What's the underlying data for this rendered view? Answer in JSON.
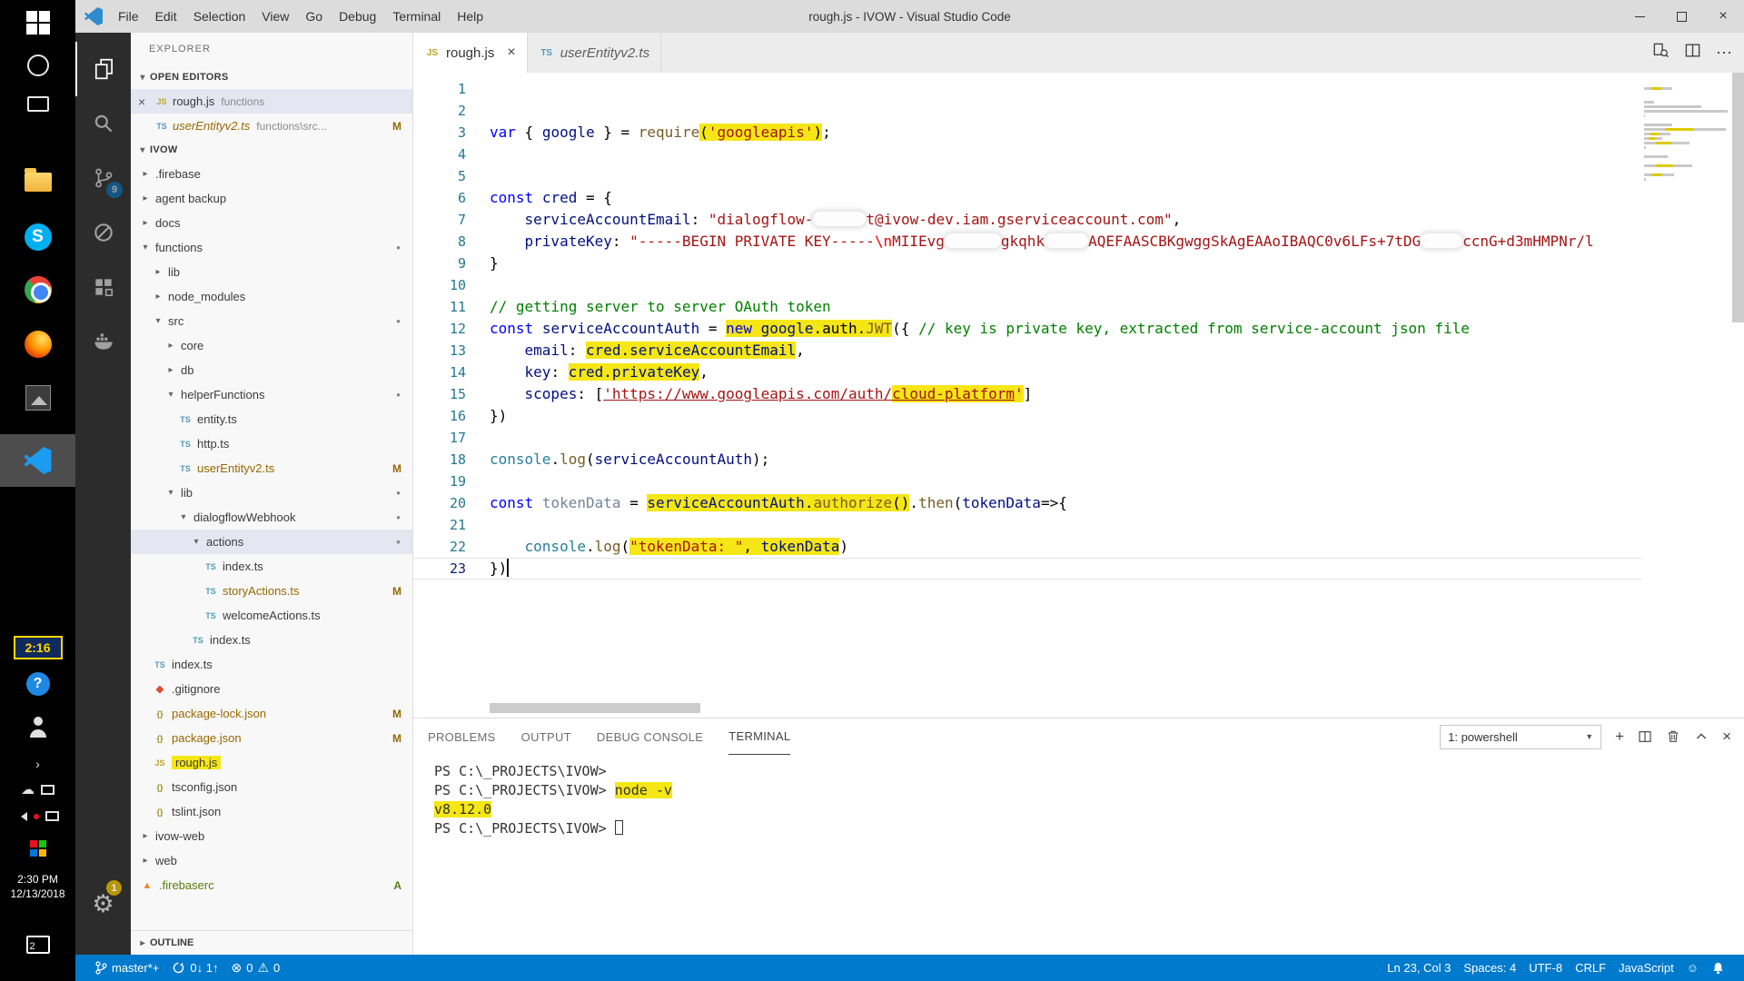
{
  "icons": {
    "chevron_open": "▾",
    "chevron_closed": "▸",
    "file_ts": "TS",
    "file_js": "JS",
    "file_json": "{}",
    "file_git": "◆",
    "file_fire": "▲",
    "gear": "⚙",
    "smiley": "☺",
    "error": "⊗",
    "warning": "⚠",
    "dropdown_arrow": "▼",
    "ellipsis": "⋯",
    "plus": "+",
    "close": "×",
    "cloud": "☁",
    "tray_chevron": "›",
    "modified_dot": "●"
  },
  "taskbar": {
    "timer_badge": "2:16",
    "clock_time": "2:30 PM",
    "clock_date": "12/13/2018",
    "notification_count": "2"
  },
  "titlebar": {
    "title": "rough.js - IVOW - Visual Studio Code",
    "menus": [
      "File",
      "Edit",
      "Selection",
      "View",
      "Go",
      "Debug",
      "Terminal",
      "Help"
    ]
  },
  "activitybar": {
    "scm_badge": "9",
    "manage_badge": "1"
  },
  "sidebar": {
    "title": "EXPLORER",
    "open_editors": {
      "header": "OPEN EDITORS",
      "items": [
        {
          "icon": "js",
          "name": "rough.js",
          "detail": "functions",
          "active": true,
          "close": true
        },
        {
          "icon": "ts",
          "name": "userEntityv2.ts",
          "detail": "functions\\src...",
          "badge": "M",
          "modified": true,
          "italic": true
        }
      ]
    },
    "project": {
      "header": "IVOW",
      "items": [
        {
          "label": ".firebase",
          "indent": 1,
          "kind": "folder",
          "state": "closed"
        },
        {
          "label": "agent backup",
          "indent": 1,
          "kind": "folder",
          "state": "closed"
        },
        {
          "label": "docs",
          "indent": 1,
          "kind": "folder",
          "state": "closed"
        },
        {
          "label": "functions",
          "indent": 1,
          "kind": "folder",
          "state": "open",
          "dot": true
        },
        {
          "label": "lib",
          "indent": 2,
          "kind": "folder",
          "state": "closed"
        },
        {
          "label": "node_modules",
          "indent": 2,
          "kind": "folder",
          "state": "closed"
        },
        {
          "label": "src",
          "indent": 2,
          "kind": "folder",
          "state": "open",
          "dot": true
        },
        {
          "label": "core",
          "indent": 3,
          "kind": "folder",
          "state": "closed"
        },
        {
          "label": "db",
          "indent": 3,
          "kind": "folder",
          "state": "closed"
        },
        {
          "label": "helperFunctions",
          "indent": 3,
          "kind": "folder",
          "state": "open",
          "dot": true
        },
        {
          "label": "entity.ts",
          "indent": 4,
          "kind": "file",
          "icon": "ts"
        },
        {
          "label": "http.ts",
          "indent": 4,
          "kind": "file",
          "icon": "ts"
        },
        {
          "label": "userEntityv2.ts",
          "indent": 4,
          "kind": "file",
          "icon": "ts",
          "badge": "M",
          "modified": true
        },
        {
          "label": "lib",
          "indent": 3,
          "kind": "folder",
          "state": "open",
          "dot": true
        },
        {
          "label": "dialogflowWebhook",
          "indent": 4,
          "kind": "folder",
          "state": "open",
          "dot": true
        },
        {
          "label": "actions",
          "indent": 5,
          "kind": "folder",
          "state": "open",
          "dot": true,
          "selected": true
        },
        {
          "label": "index.ts",
          "indent": 6,
          "kind": "file",
          "icon": "ts"
        },
        {
          "label": "storyActions.ts",
          "indent": 6,
          "kind": "file",
          "icon": "ts",
          "badge": "M",
          "modified": true
        },
        {
          "label": "welcomeActions.ts",
          "indent": 6,
          "kind": "file",
          "icon": "ts"
        },
        {
          "label": "index.ts",
          "indent": 5,
          "kind": "file",
          "icon": "ts"
        },
        {
          "label": "index.ts",
          "indent": 2,
          "kind": "file",
          "icon": "ts"
        },
        {
          "label": ".gitignore",
          "indent": 2,
          "kind": "file",
          "icon": "git"
        },
        {
          "label": "package-lock.json",
          "indent": 2,
          "kind": "file",
          "icon": "json",
          "badge": "M",
          "modified": true
        },
        {
          "label": "package.json",
          "indent": 2,
          "kind": "file",
          "icon": "json",
          "badge": "M",
          "modified": true
        },
        {
          "label": "rough.js",
          "indent": 2,
          "kind": "file",
          "icon": "js",
          "hl": true
        },
        {
          "label": "tsconfig.json",
          "indent": 2,
          "kind": "file",
          "icon": "json"
        },
        {
          "label": "tslint.json",
          "indent": 2,
          "kind": "file",
          "icon": "json"
        },
        {
          "label": "ivow-web",
          "indent": 1,
          "kind": "folder",
          "state": "closed"
        },
        {
          "label": "web",
          "indent": 1,
          "kind": "folder",
          "state": "closed"
        },
        {
          "label": ".firebaserc",
          "indent": 1,
          "kind": "file",
          "icon": "fire",
          "badge": "A",
          "added": true
        }
      ]
    },
    "outline_header": "OUTLINE"
  },
  "editor": {
    "tabs": [
      {
        "icon": "js",
        "label": "rough.js",
        "active": true,
        "close": "×"
      },
      {
        "icon": "ts",
        "label": "userEntityv2.ts",
        "preview": true
      }
    ],
    "lines": [
      {
        "n": 1,
        "s": []
      },
      {
        "n": 2,
        "s": []
      },
      {
        "n": 3,
        "s": [
          {
            "t": "var",
            "c": "k"
          },
          {
            "t": " { "
          },
          {
            "t": "google",
            "c": "v"
          },
          {
            "t": " } = "
          },
          {
            "t": "require",
            "c": "f"
          },
          {
            "t": "(",
            "h": true
          },
          {
            "t": "'googleapis'",
            "c": "s",
            "h": true
          },
          {
            "t": ")",
            "h": true
          },
          {
            "t": ";"
          }
        ]
      },
      {
        "n": 4,
        "s": []
      },
      {
        "n": 5,
        "s": []
      },
      {
        "n": 6,
        "s": [
          {
            "t": "const",
            "c": "k"
          },
          {
            "t": " "
          },
          {
            "t": "cred",
            "c": "v"
          },
          {
            "t": " = {"
          }
        ]
      },
      {
        "n": 7,
        "s": [
          {
            "t": "    "
          },
          {
            "t": "serviceAccountEmail",
            "c": "v"
          },
          {
            "t": ": "
          },
          {
            "t": "\"dialogflow-",
            "c": "s"
          },
          {
            "r": 58
          },
          {
            "t": "t@ivow-dev.iam.gserviceaccount.com\"",
            "c": "s"
          },
          {
            "t": ","
          }
        ]
      },
      {
        "n": 8,
        "s": [
          {
            "t": "    "
          },
          {
            "t": "privateKey",
            "c": "v"
          },
          {
            "t": ": "
          },
          {
            "t": "\"-----BEGIN PRIVATE KEY-----",
            "c": "s"
          },
          {
            "t": "\\n",
            "c": "e"
          },
          {
            "t": "MIIEvg",
            "c": "s"
          },
          {
            "r": 62
          },
          {
            "t": "gkqhk",
            "c": "s"
          },
          {
            "r": 48
          },
          {
            "t": "AQEFAASCBKgwggSkAgEAAoIBAQC0v6LFs+7tDG",
            "c": "s"
          },
          {
            "r": 46
          },
          {
            "t": "ccnG+d3mHMPNr/l",
            "c": "s"
          }
        ]
      },
      {
        "n": 9,
        "s": [
          {
            "t": "}"
          }
        ]
      },
      {
        "n": 10,
        "s": []
      },
      {
        "n": 11,
        "s": [
          {
            "t": "// getting server to server OAuth token",
            "c": "m"
          }
        ]
      },
      {
        "n": 12,
        "s": [
          {
            "t": "const",
            "c": "k"
          },
          {
            "t": " "
          },
          {
            "t": "serviceAccountAuth",
            "c": "v"
          },
          {
            "t": " = "
          },
          {
            "t": "new",
            "c": "k",
            "h": true
          },
          {
            "t": " ",
            "h": true
          },
          {
            "t": "google",
            "c": "v",
            "h": true
          },
          {
            "t": ".auth.",
            "h": true
          },
          {
            "t": "JWT",
            "c": "f",
            "h": true
          },
          {
            "t": "({ "
          },
          {
            "t": "// key is private key, extracted from service-account json file",
            "c": "m"
          }
        ]
      },
      {
        "n": 13,
        "s": [
          {
            "t": "    "
          },
          {
            "t": "email",
            "c": "v"
          },
          {
            "t": ": "
          },
          {
            "t": "cred",
            "c": "v",
            "h": true
          },
          {
            "t": ".",
            "h": true
          },
          {
            "t": "serviceAccountEmail",
            "c": "v",
            "h": true
          },
          {
            "t": ","
          }
        ]
      },
      {
        "n": 14,
        "s": [
          {
            "t": "    "
          },
          {
            "t": "key",
            "c": "v"
          },
          {
            "t": ": "
          },
          {
            "t": "cred",
            "c": "v",
            "h": true
          },
          {
            "t": ".",
            "h": true
          },
          {
            "t": "privateKey",
            "c": "v",
            "h": true
          },
          {
            "t": ","
          }
        ]
      },
      {
        "n": 15,
        "s": [
          {
            "t": "    "
          },
          {
            "t": "scopes",
            "c": "v"
          },
          {
            "t": ": ["
          },
          {
            "t": "'https://www.googleapis.com/auth/",
            "c": "s",
            "u": true
          },
          {
            "t": "cloud-platform",
            "c": "s",
            "u": true,
            "h": true
          },
          {
            "t": "'",
            "c": "s",
            "h": true
          },
          {
            "t": "]"
          }
        ]
      },
      {
        "n": 16,
        "s": [
          {
            "t": "})"
          }
        ]
      },
      {
        "n": 17,
        "s": []
      },
      {
        "n": 18,
        "s": [
          {
            "t": "console",
            "c": "t"
          },
          {
            "t": "."
          },
          {
            "t": "log",
            "c": "f"
          },
          {
            "t": "("
          },
          {
            "t": "serviceAccountAuth",
            "c": "v"
          },
          {
            "t": ");"
          }
        ]
      },
      {
        "n": 19,
        "s": []
      },
      {
        "n": 20,
        "s": [
          {
            "t": "const",
            "c": "k"
          },
          {
            "t": " "
          },
          {
            "t": "tokenData",
            "c": "d"
          },
          {
            "t": " = "
          },
          {
            "t": "serviceAccountAuth",
            "c": "v",
            "h": true
          },
          {
            "t": ".",
            "h": true
          },
          {
            "t": "authorize",
            "c": "f",
            "h": true
          },
          {
            "t": "()",
            "h": true
          },
          {
            "t": "."
          },
          {
            "t": "then",
            "c": "f"
          },
          {
            "t": "("
          },
          {
            "t": "tokenData",
            "c": "v"
          },
          {
            "t": "=>{"
          }
        ]
      },
      {
        "n": 21,
        "s": []
      },
      {
        "n": 22,
        "s": [
          {
            "t": "    "
          },
          {
            "t": "console",
            "c": "t"
          },
          {
            "t": "."
          },
          {
            "t": "log",
            "c": "f"
          },
          {
            "t": "("
          },
          {
            "t": "\"tokenData: \"",
            "c": "s",
            "h": true
          },
          {
            "t": ", ",
            "h": true
          },
          {
            "t": "tokenData",
            "c": "v",
            "h": true
          },
          {
            "t": ")"
          }
        ]
      },
      {
        "n": 23,
        "cur": true,
        "s": [
          {
            "t": "})"
          },
          {
            "caret": true
          }
        ]
      }
    ]
  },
  "panel": {
    "tabs": [
      "PROBLEMS",
      "OUTPUT",
      "DEBUG CONSOLE",
      "TERMINAL"
    ],
    "active": "TERMINAL",
    "terminal": {
      "selector": "1: powershell",
      "lines": [
        [
          {
            "t": "PS C:\\_PROJECTS\\IVOW> "
          }
        ],
        [
          {
            "t": "PS C:\\_PROJECTS\\IVOW> "
          },
          {
            "t": "node -v",
            "h": true
          }
        ],
        [
          {
            "t": "v8.12.0",
            "h": true
          }
        ],
        [
          {
            "t": "PS C:\\_PROJECTS\\IVOW> "
          },
          {
            "cursor": true
          }
        ]
      ]
    }
  },
  "statusbar": {
    "branch": "master*+",
    "sync": "0↓ 1↑",
    "errors": "0",
    "warnings": "0",
    "line_col": "Ln 23, Col 3",
    "spaces": "Spaces: 4",
    "encoding": "UTF-8",
    "eol": "CRLF",
    "language": "JavaScript"
  }
}
